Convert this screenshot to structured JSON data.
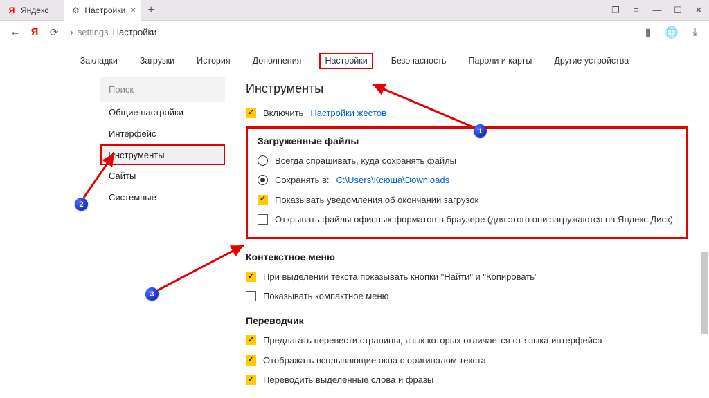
{
  "titlebar": {
    "tabs": [
      {
        "title": "Яндекс",
        "favicon": "Я",
        "fav_color": "#ff0000"
      },
      {
        "title": "Настройки",
        "favicon": "⚙",
        "fav_color": "#555"
      }
    ]
  },
  "addressbar": {
    "path": "settings",
    "title": "Настройки"
  },
  "settings_tabs": [
    "Закладки",
    "Загрузки",
    "История",
    "Дополнения",
    "Настройки",
    "Безопасность",
    "Пароли и карты",
    "Другие устройства"
  ],
  "settings_tabs_highlight_index": 4,
  "sidebar": {
    "search_placeholder": "Поиск",
    "items": [
      "Общие настройки",
      "Интерфейс",
      "Инструменты",
      "Сайты",
      "Системные"
    ],
    "highlight_index": 2
  },
  "pane": {
    "heading": "Инструменты",
    "enable_label": "Включить",
    "gestures_link": "Настройки жестов",
    "downloaded": {
      "title": "Загруженные файлы",
      "ask_label": "Всегда спрашивать, куда сохранять файлы",
      "save_label": "Сохранять в:",
      "save_path": "C:\\Users\\Ксюша\\Downloads",
      "notify_label": "Показывать уведомления об окончании загрузок",
      "office_label": "Открывать файлы офисных форматов в браузере (для этого они загружаются на Яндекс.Диск)"
    },
    "context": {
      "title": "Контекстное меню",
      "find_copy_label": "При выделении текста показывать кнопки \"Найти\" и \"Копировать\"",
      "compact_label": "Показывать компактное меню"
    },
    "translator": {
      "title": "Переводчик",
      "offer_label": "Предлагать перевести страницы, язык которых отличается от языка интерфейса",
      "popups_label": "Отображать всплывающие окна с оригиналом текста",
      "selected_label": "Переводить выделенные слова и фразы"
    }
  },
  "badges": {
    "b1": "1",
    "b2": "2",
    "b3": "3"
  }
}
